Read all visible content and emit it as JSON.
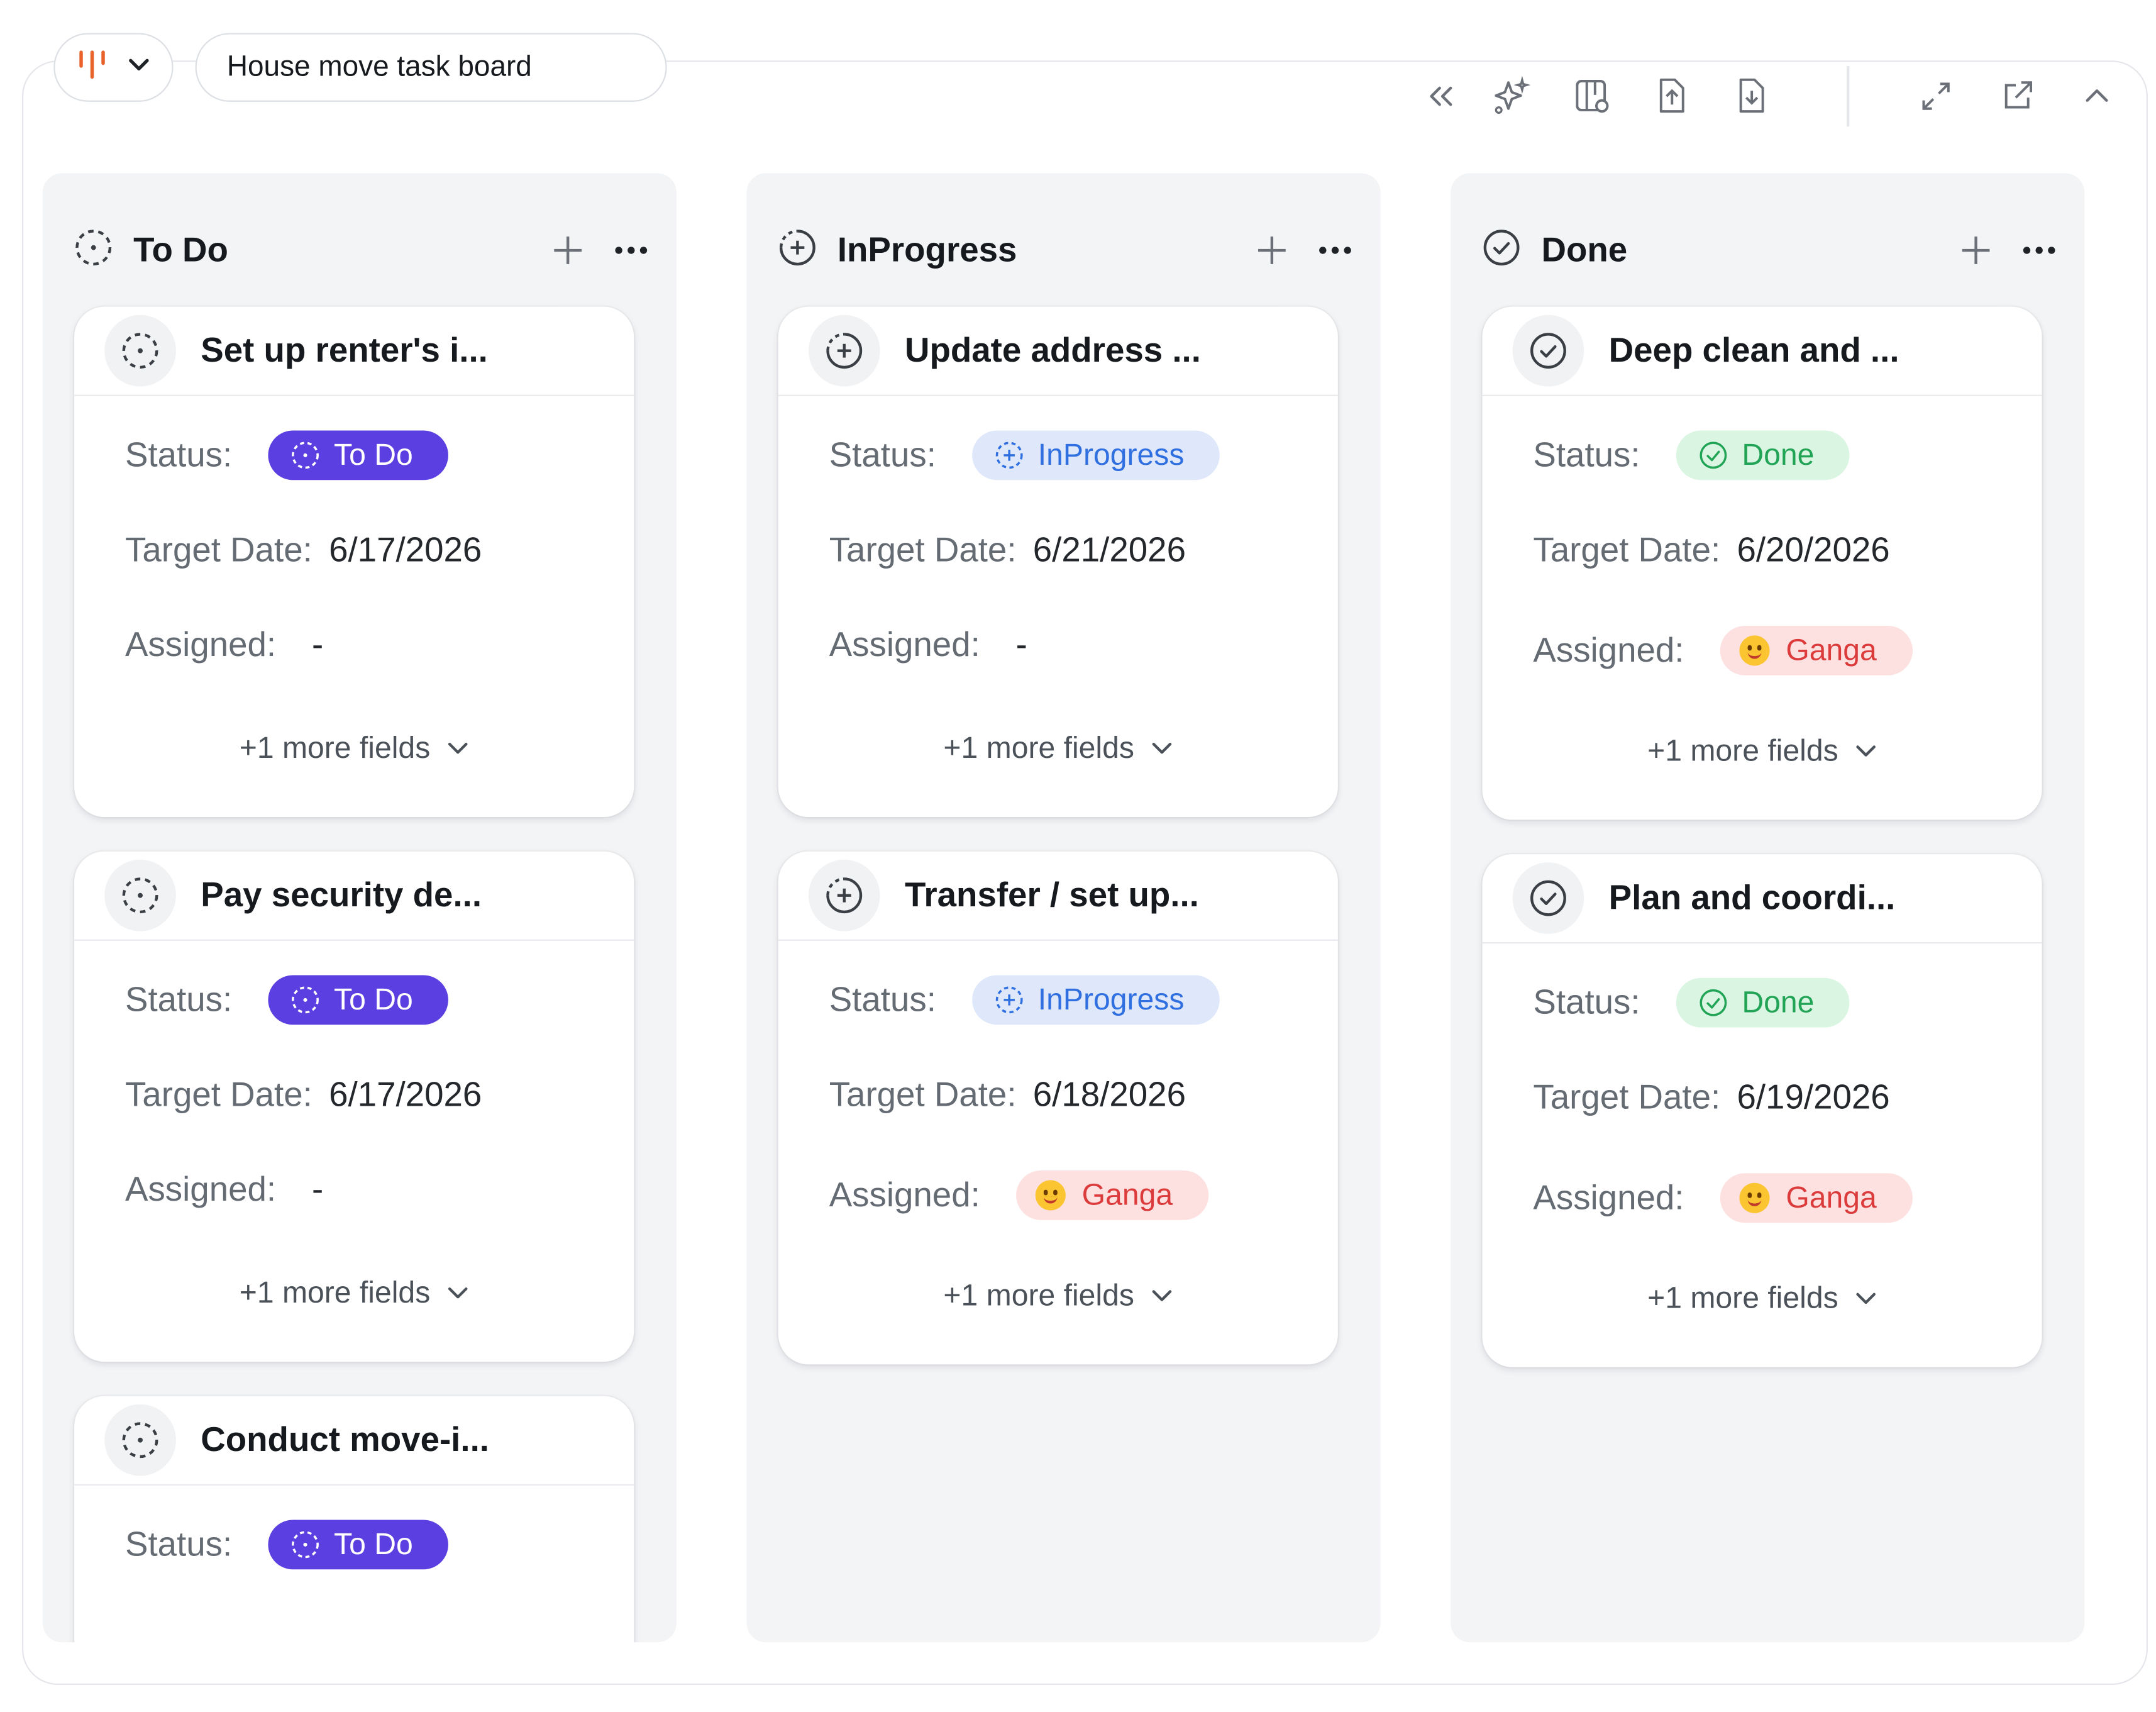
{
  "header": {
    "board_title": "House move task board",
    "view_icon": "board-view-icon"
  },
  "toolbar": {
    "icons": [
      "collapse-left-icon",
      "sparkle-ai-icon",
      "board-settings-icon",
      "export-upload-icon",
      "import-download-icon",
      "expand-icon",
      "open-external-icon",
      "collapse-up-icon"
    ]
  },
  "columns": [
    {
      "title": "To Do",
      "icon": "dotted-circle-icon",
      "cards": [
        {
          "title": "Set up renter's i...",
          "status": "To Do",
          "target_date": "6/17/2026",
          "assigned": "-",
          "more": "+1 more fields"
        },
        {
          "title": "Pay security de...",
          "status": "To Do",
          "target_date": "6/17/2026",
          "assigned": "-",
          "more": "+1 more fields"
        },
        {
          "title": "Conduct move-i...",
          "status": "To Do"
        }
      ]
    },
    {
      "title": "InProgress",
      "icon": "plus-circle-icon",
      "cards": [
        {
          "title": "Update address ...",
          "status": "InProgress",
          "target_date": "6/21/2026",
          "assigned": "-",
          "more": "+1 more fields"
        },
        {
          "title": "Transfer / set up...",
          "status": "InProgress",
          "target_date": "6/18/2026",
          "assigned": "Ganga",
          "more": "+1 more fields"
        }
      ]
    },
    {
      "title": "Done",
      "icon": "check-circle-icon",
      "cards": [
        {
          "title": "Deep clean and ...",
          "status": "Done",
          "target_date": "6/20/2026",
          "assigned": "Ganga",
          "more": "+1 more fields"
        },
        {
          "title": "Plan and coordi...",
          "status": "Done",
          "target_date": "6/19/2026",
          "assigned": "Ganga",
          "more": "+1 more fields"
        }
      ]
    }
  ],
  "labels": {
    "status": "Status:",
    "target_date": "Target Date:",
    "assigned": "Assigned:"
  },
  "colors": {
    "todo_badge": "#5b3fe0",
    "inprogress_badge": "#dfe8fb",
    "done_badge": "#daf5e2",
    "assignee_badge": "#fde1e1",
    "brand_orange": "#e8622a"
  }
}
